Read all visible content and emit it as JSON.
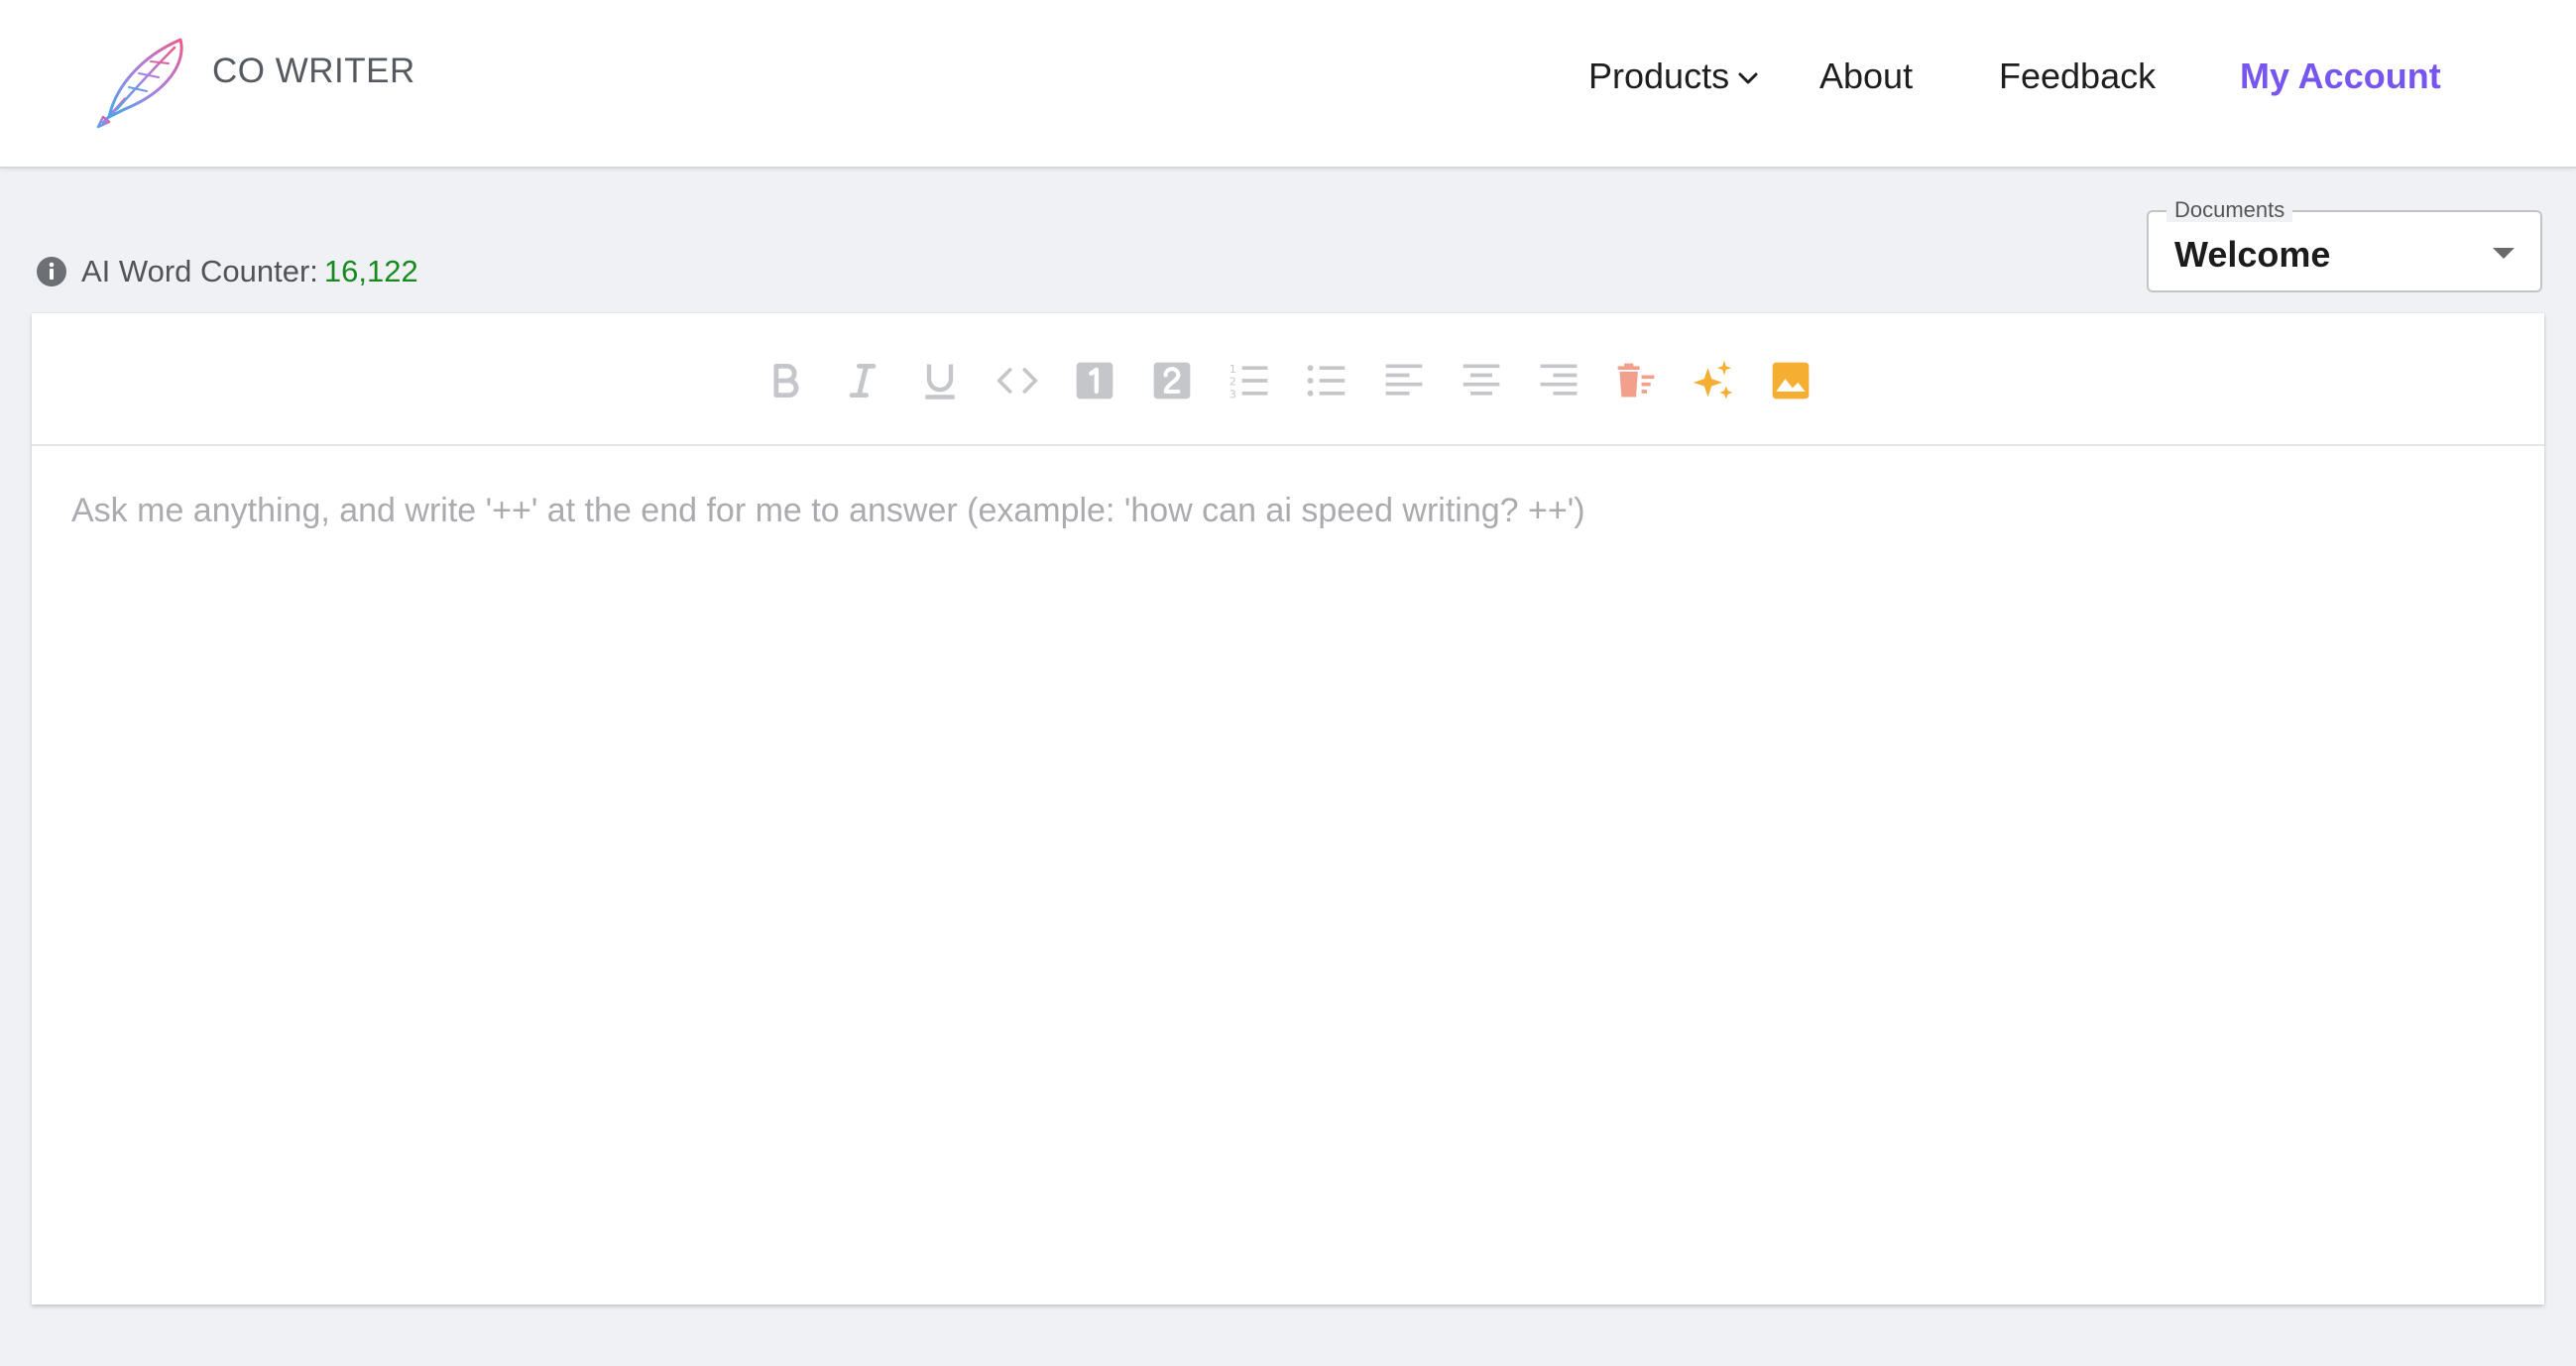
{
  "header": {
    "brand": "CO WRITER",
    "nav": {
      "products": "Products",
      "about": "About",
      "feedback": "Feedback",
      "account": "My Account"
    }
  },
  "counter": {
    "label": "AI Word Counter:",
    "value": "16,122"
  },
  "documents": {
    "legend": "Documents",
    "selected": "Welcome"
  },
  "toolbar": {
    "icons": [
      "bold-icon",
      "italic-icon",
      "underline-icon",
      "code-icon",
      "heading-1-icon",
      "heading-2-icon",
      "ordered-list-icon",
      "bullet-list-icon",
      "align-left-icon",
      "align-center-icon",
      "align-right-icon",
      "clear-format-icon",
      "ai-sparkle-icon",
      "image-icon"
    ]
  },
  "editor": {
    "placeholder": "Ask me anything, and write '++' at the end for me to answer (example: 'how can ai speed writing? ++')"
  },
  "colors": {
    "accent": "#7756f0",
    "counter_value": "#168a1e",
    "toolbar_gray": "#c4c6c9",
    "clear_icon": "#f2a08c",
    "sparkle_icon": "#f5ae32",
    "image_icon": "#f5ae32"
  }
}
